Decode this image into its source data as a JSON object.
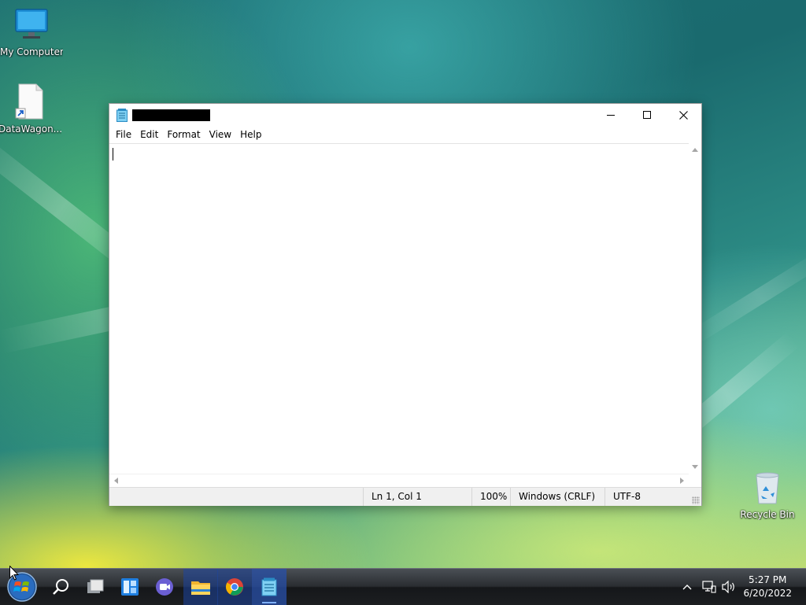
{
  "desktop": {
    "icons": [
      {
        "label": "My Computer",
        "icon": "monitor-icon"
      },
      {
        "label": "DataWagon...",
        "icon": "shortcut-file-icon"
      },
      {
        "label": "Recycle Bin",
        "icon": "recycle-bin-icon"
      }
    ]
  },
  "notepad": {
    "title": "",
    "menu": [
      "File",
      "Edit",
      "Format",
      "View",
      "Help"
    ],
    "content": "",
    "status": {
      "position": "Ln 1, Col 1",
      "zoom": "100%",
      "line_ending": "Windows (CRLF)",
      "encoding": "UTF-8"
    },
    "controls": [
      "minimize-icon",
      "maximize-icon",
      "close-icon"
    ]
  },
  "taskbar": {
    "buttons": [
      "start-orb-icon",
      "search-icon",
      "task-view-icon",
      "widgets-icon",
      "chat-icon",
      "file-explorer-icon",
      "chrome-icon",
      "notepad-icon"
    ],
    "tray": [
      "chevron-up-icon",
      "network-icon",
      "volume-icon"
    ],
    "clock": {
      "time": "5:27 PM",
      "date": "6/20/2022"
    }
  },
  "colors": {
    "accent": "#2b6cd8",
    "taskbar": "#1c1e21"
  }
}
